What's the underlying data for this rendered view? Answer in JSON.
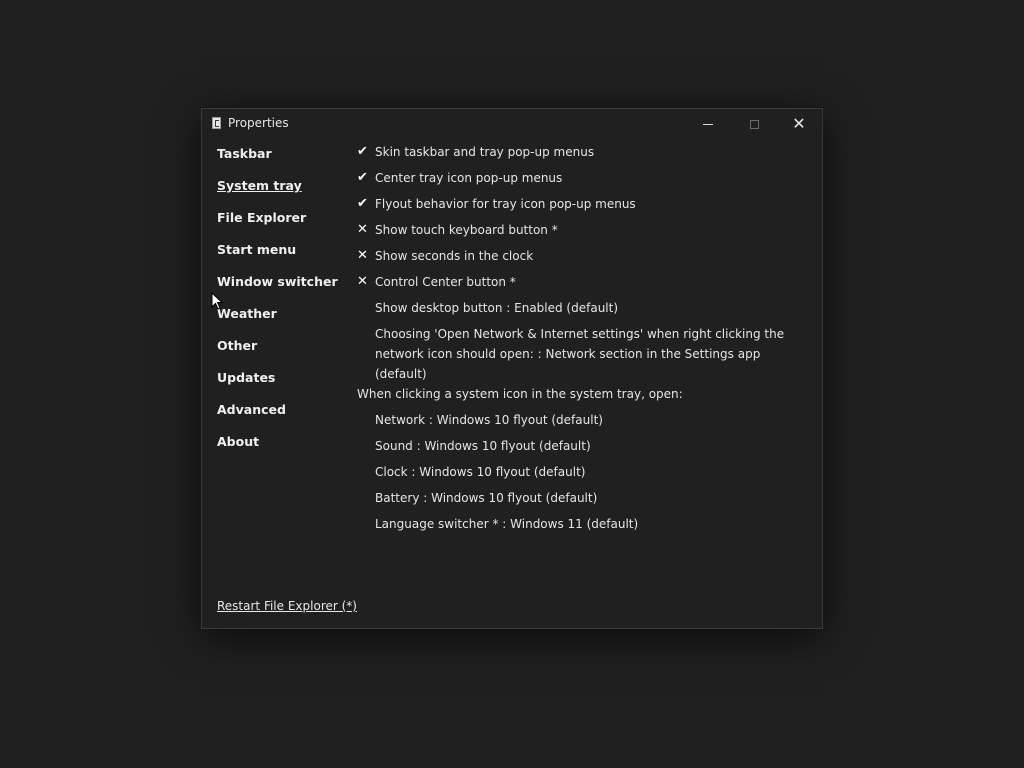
{
  "window": {
    "title": "Properties",
    "icon": "app-file-icon",
    "caption_buttons": {
      "minimize": "minimize-icon",
      "maximize": "maximize-icon",
      "close": "✕"
    }
  },
  "sidebar": {
    "items": [
      {
        "label": "Taskbar",
        "active": false
      },
      {
        "label": "System tray",
        "active": true
      },
      {
        "label": "File Explorer",
        "active": false
      },
      {
        "label": "Start menu",
        "active": false
      },
      {
        "label": "Window switcher",
        "active": false
      },
      {
        "label": "Weather",
        "active": false
      },
      {
        "label": "Other",
        "active": false
      },
      {
        "label": "Updates",
        "active": false
      },
      {
        "label": "Advanced",
        "active": false
      },
      {
        "label": "About",
        "active": false
      }
    ]
  },
  "settings": {
    "rows": [
      {
        "mark": "✔",
        "state": "checked",
        "label": "Skin taskbar and tray pop-up menus"
      },
      {
        "mark": "✔",
        "state": "checked",
        "label": "Center tray icon pop-up menus"
      },
      {
        "mark": "✔",
        "state": "checked",
        "label": "Flyout behavior for tray icon pop-up menus"
      },
      {
        "mark": "✕",
        "state": "unchecked",
        "label": "Show touch keyboard button *"
      },
      {
        "mark": "✕",
        "state": "unchecked",
        "label": "Show seconds in the clock"
      },
      {
        "mark": "✕",
        "state": "unchecked",
        "label": "Control Center button *"
      },
      {
        "mark": "",
        "state": "option",
        "label": "Show desktop button : Enabled (default)"
      },
      {
        "mark": "",
        "state": "option",
        "label": "Choosing 'Open Network & Internet settings' when right clicking the network icon should open: : Network section in the Settings app (default)"
      }
    ],
    "group_heading": "When clicking a system icon in the system tray, open:",
    "group_rows": [
      {
        "label": "Network : Windows 10 flyout (default)"
      },
      {
        "label": "Sound : Windows 10 flyout (default)"
      },
      {
        "label": "Clock : Windows 10 flyout (default)"
      },
      {
        "label": "Battery : Windows 10 flyout (default)"
      },
      {
        "label": "Language switcher * : Windows 11 (default)"
      }
    ]
  },
  "footer": {
    "restart_link": "Restart File Explorer (*)"
  },
  "colors": {
    "background": "#202020",
    "text": "#e8e8e8",
    "border": "#3a3a3a"
  }
}
